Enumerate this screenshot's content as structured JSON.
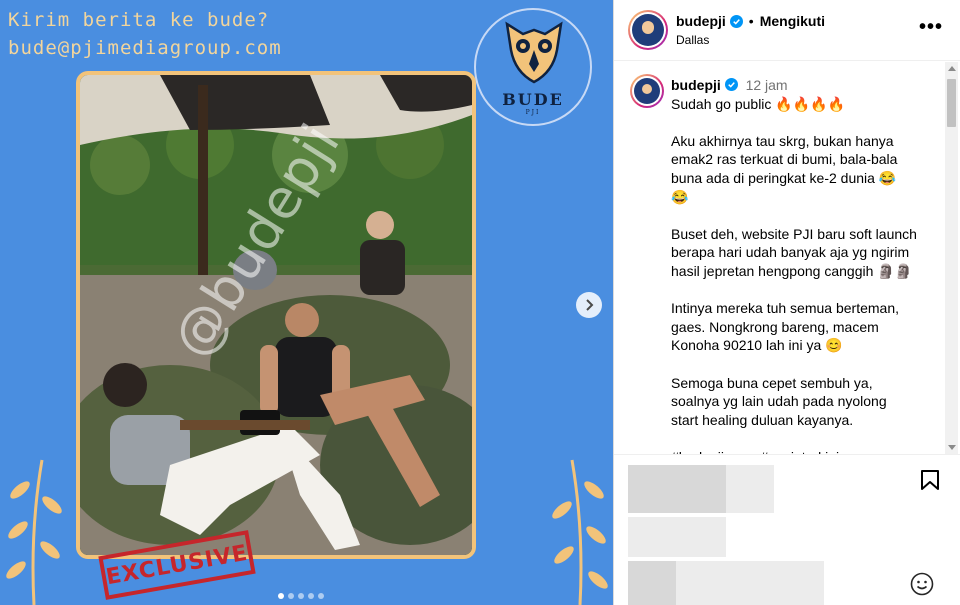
{
  "media": {
    "promo_line_1": "Kirim berita ke bude?",
    "promo_line_2": "bude@pjimediagroup.com",
    "logo_text": "BUDE",
    "logo_sub": "PJI",
    "watermark": "@budepji",
    "stamp": "EXCLUSIVE",
    "carousel": {
      "count": 5,
      "active_index": 0
    }
  },
  "header": {
    "username": "budepji",
    "separator": "•",
    "follow_label": "Mengikuti",
    "location": "Dallas",
    "more_icon": "more-horizontal-icon"
  },
  "caption": {
    "username": "budepji",
    "time": "12 jam",
    "paragraphs": [
      [
        "Sudah go public 🔥🔥🔥🔥"
      ],
      [
        "Aku akhirnya tau skrg, bukan hanya",
        "emak2 ras terkuat di bumi, bala-bala",
        "buna ada di peringkat ke-2 dunia 😂",
        "😂"
      ],
      [
        "Buset deh, website PJI baru soft launch",
        "berapa hari udah banyak aja yg ngirim",
        "hasil jepretan hengpong canggih 🗿🗿"
      ],
      [
        "Intinya mereka tuh semua berteman,",
        "gaes. Nongkrong bareng, macem",
        "Konoha 90210 lah ini ya 😊"
      ],
      [
        "Semoga buna cepet sembuh ya,",
        "soalnya yg lain udah pada nyolong",
        "start healing duluan kayanya."
      ],
      [
        "#budepjinews #gosipterkini"
      ]
    ]
  },
  "colors": {
    "media_bg": "#4a8ee0",
    "promo_text": "#f2d59c",
    "verified": "#0095f6",
    "stamp": "#c6262b"
  }
}
